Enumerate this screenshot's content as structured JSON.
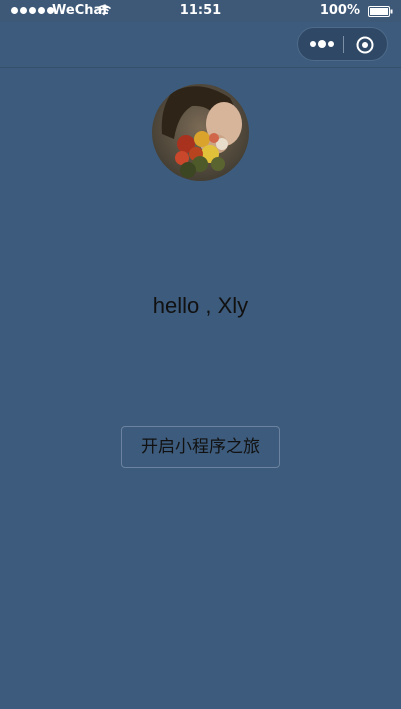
{
  "status_bar": {
    "carrier": "WeChat",
    "time": "11:51",
    "battery": "100%"
  },
  "nav": {
    "menu_icon": "more-dots-icon",
    "close_icon": "target-close-icon"
  },
  "profile": {
    "avatar_icon": "avatar-photo",
    "greeting": "hello , Xly"
  },
  "action": {
    "start_label": "开启小程序之旅"
  },
  "colors": {
    "background": "#3d5b7c",
    "text": "#111111",
    "button_border": "#6b83a0"
  }
}
